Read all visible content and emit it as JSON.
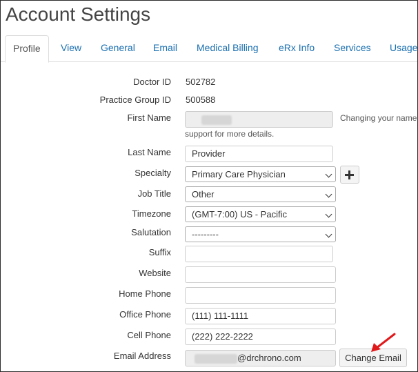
{
  "page_title": "Account Settings",
  "tabs": [
    "Profile",
    "View",
    "General",
    "Email",
    "Medical Billing",
    "eRx Info",
    "Services",
    "Usage"
  ],
  "fields": {
    "doctor_id": {
      "label": "Doctor ID",
      "value": "502782"
    },
    "practice_group_id": {
      "label": "Practice Group ID",
      "value": "500588"
    },
    "first_name": {
      "label": "First Name",
      "help": "Changing your name",
      "help2": "support for more details."
    },
    "last_name": {
      "label": "Last Name",
      "value": "Provider"
    },
    "specialty": {
      "label": "Specialty",
      "value": "Primary Care Physician"
    },
    "job_title": {
      "label": "Job Title",
      "value": "Other"
    },
    "timezone": {
      "label": "Timezone",
      "value": "(GMT-7:00) US - Pacific"
    },
    "salutation": {
      "label": "Salutation",
      "value": "---------"
    },
    "suffix": {
      "label": "Suffix",
      "value": ""
    },
    "website": {
      "label": "Website",
      "value": ""
    },
    "home_phone": {
      "label": "Home Phone",
      "value": ""
    },
    "office_phone": {
      "label": "Office Phone",
      "value": "(111) 111-1111"
    },
    "cell_phone": {
      "label": "Cell Phone",
      "value": "(222) 222-2222"
    },
    "email": {
      "label": "Email Address",
      "value": "@drchrono.com"
    }
  },
  "buttons": {
    "add_specialty_icon": "plus-icon",
    "change_email": "Change Email"
  },
  "colors": {
    "link": "#1a6fb0",
    "arrow": "#e0191b"
  }
}
